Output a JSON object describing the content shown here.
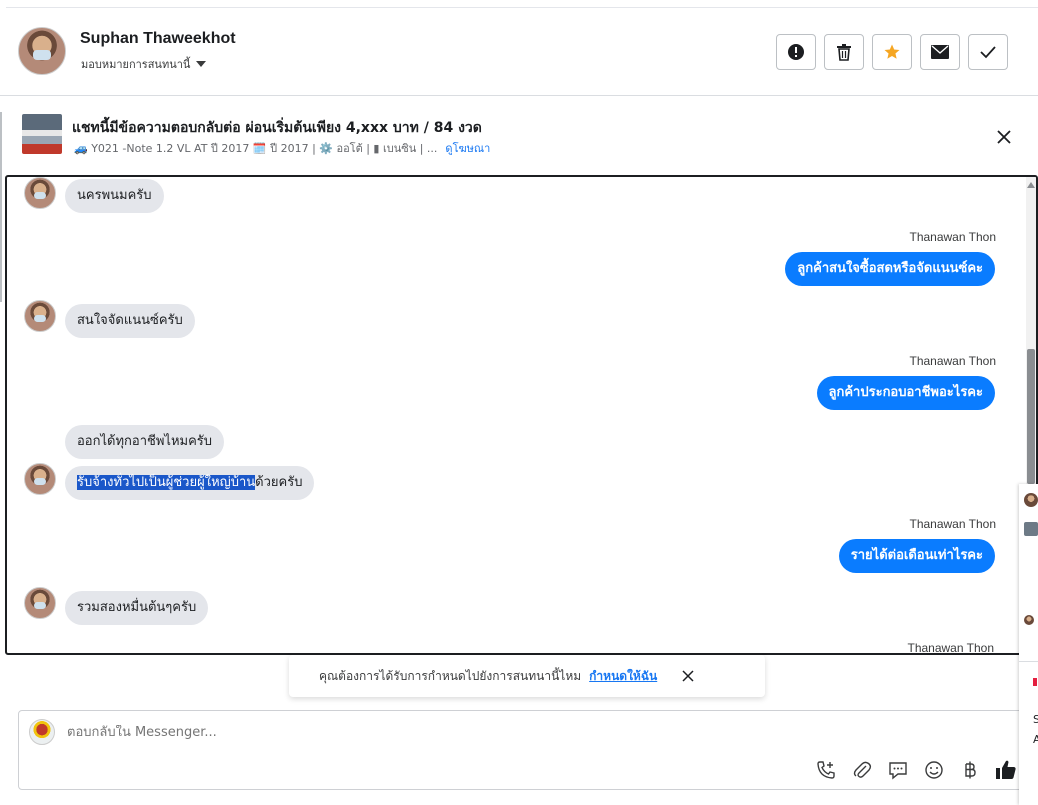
{
  "header": {
    "name": "Suphan Thaweekhot",
    "assign_label": "มอบหมายการสนทนานี้",
    "actions": [
      {
        "icon": "exclamation-icon"
      },
      {
        "icon": "trash-icon"
      },
      {
        "icon": "star-icon",
        "color": "#f5a623"
      },
      {
        "icon": "envelope-icon"
      },
      {
        "icon": "check-icon"
      }
    ]
  },
  "ad": {
    "title": "แชทนี้มีข้อความตอบกลับต่อ ผ่อนเริ่มต้นเพียง 4,xxx บาท / 84 งวด",
    "subtitle": "🚙 Y021 -Note 1.2 VL AT ปี 2017 🗓️ ปี 2017 | ⚙️ ออโต้ | ▮ เบนซิน | ...",
    "link": "ดูโฆษณา"
  },
  "messages": {
    "m1": "นครพนมครับ",
    "m2_sender": "Thanawan Thon",
    "m2": "ลูกค้าสนใจซื้อสดหรือจัดแนนซ์คะ",
    "m3": "สนใจจัดแนนซ์ครับ",
    "m4_sender": "Thanawan Thon",
    "m4": "ลูกค้าประกอบอาชีพอะไรคะ",
    "m5": "ออกได้ทุกอาชีพไหมครับ",
    "m6_selected": "รับจ้างทั่วไปเป็นผู้ช่วยผู้ใหญ่บ้าน",
    "m6_rest": "ด้วยครับ",
    "m7_sender": "Thanawan Thon",
    "m7": "รายได้ต่อเดือนเท่าไรคะ",
    "m8": "รวมสองหมื่นต้นๆครับ",
    "m9_sender": "Thanawan Thon"
  },
  "notification": {
    "text": "คุณต้องการได้รับการกำหนดไปยังการสนทนานี้ไหม",
    "link": "กำหนดให้ฉัน"
  },
  "composer": {
    "placeholder": "ตอบกลับใน Messenger...",
    "tools": [
      "phone-plus-icon",
      "paperclip-icon",
      "quick-reply-icon",
      "emoji-icon",
      "baht-icon",
      "thumbs-up-icon"
    ]
  },
  "side_panel": {
    "text_1": "S",
    "text_2": "A"
  },
  "colors": {
    "outgoing_bubble": "#0a7cff",
    "incoming_bubble": "#e4e6eb",
    "link": "#1877f2",
    "selection": "#1a57c9"
  }
}
